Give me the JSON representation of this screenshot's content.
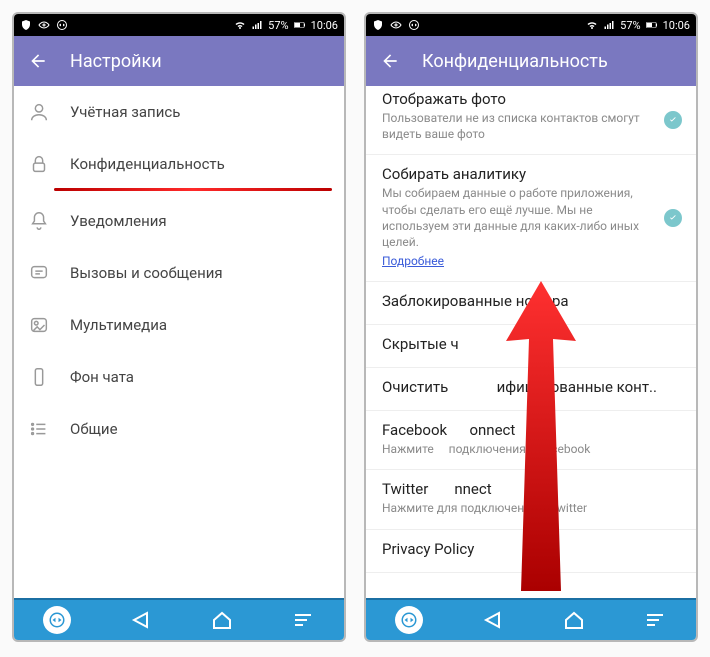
{
  "statusbar": {
    "battery": "57%",
    "time": "10:06"
  },
  "left_screen": {
    "title": "Настройки",
    "items": [
      {
        "label": "Учётная запись"
      },
      {
        "label": "Конфиденциальность",
        "highlighted": true
      },
      {
        "label": "Уведомления"
      },
      {
        "label": "Вызовы и сообщения"
      },
      {
        "label": "Мультимедиа"
      },
      {
        "label": "Фон чата"
      },
      {
        "label": "Общие"
      }
    ]
  },
  "right_screen": {
    "title": "Конфиденциальность",
    "items": [
      {
        "title": "Отображать фото",
        "sub": "Пользователи не из списка контактов смогут видеть ваше фото",
        "toggle": true
      },
      {
        "title": "Собирать аналитику",
        "sub": "Мы собираем данные о работе приложения, чтобы сделать его ещё лучше. Мы не используем эти данные для каких-либо иных целей.",
        "link": "Подробнее",
        "toggle": true
      },
      {
        "title": "Заблокированные номера"
      },
      {
        "title": "Скрытые ч"
      },
      {
        "title": "Очистить             ифицированные конт.."
      },
      {
        "title": "Facebook      onnect",
        "sub": "Нажмите     подключения к Facebook"
      },
      {
        "title": "Twitter       nnect",
        "sub": "Нажмите для подключения к Twitter"
      },
      {
        "title": "Privacy Policy"
      }
    ]
  }
}
